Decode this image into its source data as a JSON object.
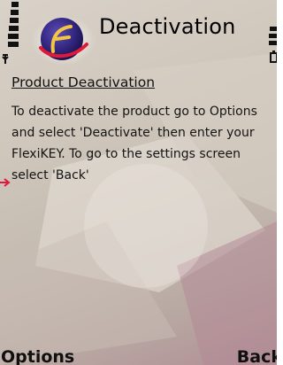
{
  "header": {
    "title": "Deactivation",
    "logo_icon": "flexikey-logo-icon"
  },
  "status": {
    "signal_icon": "signal-strength-icon",
    "battery_icon": "battery-icon"
  },
  "content": {
    "heading": "Product Deactivation",
    "lines": [
      "To deactivate the product go to Options",
      "and select 'Deactivate' then enter your",
      "FlexiKEY. To go to the settings screen",
      "select 'Back'"
    ]
  },
  "softkeys": {
    "left_label": "Options",
    "right_label": "Back"
  },
  "colors": {
    "accent_red": "#e0193a",
    "text": "#141414"
  }
}
